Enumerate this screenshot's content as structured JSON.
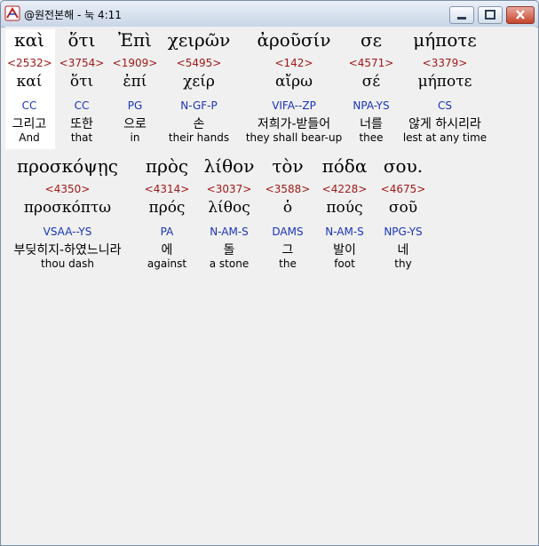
{
  "window": {
    "title": "@원전본해 - 눅 4:11"
  },
  "lines": [
    {
      "words": [
        {
          "greek": "καὶ",
          "strong": "<2532>",
          "lemma": "καί",
          "parse": "CC",
          "korean": "그리고",
          "english": "And"
        },
        {
          "greek": "ὅτι",
          "strong": "<3754>",
          "lemma": "ὅτι",
          "parse": "CC",
          "korean": "또한",
          "english": "that"
        },
        {
          "greek": "Ἐπὶ",
          "strong": "<1909>",
          "lemma": "ἐπί",
          "parse": "PG",
          "korean": "으로",
          "english": "in"
        },
        {
          "greek": "χειρῶν",
          "strong": "<5495>",
          "lemma": "χείρ",
          "parse": "N-GF-P",
          "korean": "손",
          "english": "their hands"
        },
        {
          "greek": "ἀροῦσίν",
          "strong": "<142>",
          "lemma": "αἴρω",
          "parse": "VIFA--ZP",
          "korean": "저희가-받들어",
          "english": "they shall bear-up"
        },
        {
          "greek": "σε",
          "strong": "<4571>",
          "lemma": "σέ",
          "parse": "NPA-YS",
          "korean": "너를",
          "english": "thee"
        },
        {
          "greek": "μήποτε",
          "strong": "<3379>",
          "lemma": "μήποτε",
          "parse": "CS",
          "korean": "않게 하시리라",
          "english": "lest at any time"
        }
      ]
    },
    {
      "words": [
        {
          "greek": "προσκόψῃς",
          "strong": "<4350>",
          "lemma": "προσκόπτω",
          "parse": "VSAA--YS",
          "korean": "부딪히지-하였느니라",
          "english": "thou dash"
        },
        {
          "greek": "πρὸς",
          "strong": "<4314>",
          "lemma": "πρός",
          "parse": "PA",
          "korean": "에",
          "english": "against"
        },
        {
          "greek": "λίθον",
          "strong": "<3037>",
          "lemma": "λίθος",
          "parse": "N-AM-S",
          "korean": "돌",
          "english": "a stone"
        },
        {
          "greek": "τὸν",
          "strong": "<3588>",
          "lemma": "ὁ",
          "parse": "DAMS",
          "korean": "그",
          "english": "the"
        },
        {
          "greek": "πόδα",
          "strong": "<4228>",
          "lemma": "πούς",
          "parse": "N-AM-S",
          "korean": "발이",
          "english": "foot"
        },
        {
          "greek": "σου.",
          "strong": "<4675>",
          "lemma": "σοῦ",
          "parse": "NPG-YS",
          "korean": "네",
          "english": "thy"
        }
      ]
    }
  ]
}
